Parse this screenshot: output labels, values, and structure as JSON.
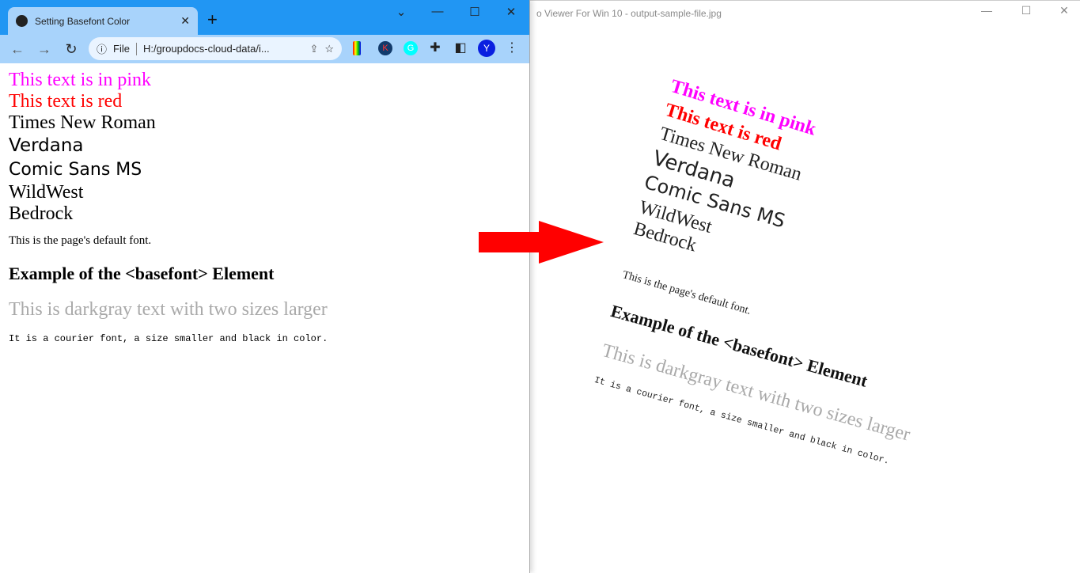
{
  "browser": {
    "tab_title": "Setting Basefont Color",
    "tab_close": "✕",
    "new_tab": "+",
    "url_scheme": "File",
    "url": "H:/groupdocs-cloud-data/i...",
    "profile_initial": "Y",
    "ext_k": "K",
    "ext_g": "G"
  },
  "page": {
    "lines": [
      "This text is in pink",
      "This text is red",
      "Times New Roman",
      "Verdana",
      "Comic Sans MS",
      "WildWest",
      "Bedrock"
    ],
    "default_font": "This is the page's default font.",
    "heading": "Example of the <basefont> Element",
    "darkgray": "This is darkgray text with two sizes larger",
    "courier": "It is a courier font, a size smaller and black in color.",
    "colors": {
      "pink": "#ff00ff",
      "red": "#ff0000",
      "darkgray": "#a9a9a9"
    }
  },
  "viewer": {
    "title": "o Viewer For Win 10 - output-sample-file.jpg"
  },
  "arrow_color": "#ff0000"
}
